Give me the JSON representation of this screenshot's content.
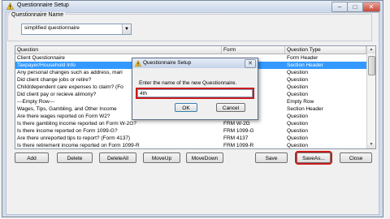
{
  "window": {
    "title": "Questionnaire Setup",
    "minimize_label": "–",
    "maximize_label": "□",
    "close_label": "✕"
  },
  "questionnaire_name": {
    "group_label": "Questionnaire Name",
    "selected_value": "simplified questionnaire",
    "arrow": "▼"
  },
  "grid": {
    "columns": [
      "Question",
      "Form",
      "Question Type"
    ],
    "rows": [
      {
        "question": "Client Questionnaire",
        "form": "",
        "type": "Form Header",
        "selected": false
      },
      {
        "question": "Taxpayer/Household Info",
        "form": "",
        "type": "Section Header",
        "selected": true
      },
      {
        "question": "Any personal changes such as address, mari",
        "form": "",
        "type": "Question",
        "selected": false
      },
      {
        "question": "Did client change jobs or retire?",
        "form": "",
        "type": "Question",
        "selected": false
      },
      {
        "question": "Child/dependent care expenses to claim? (Fo",
        "form": "",
        "type": "Question",
        "selected": false
      },
      {
        "question": "Did client pay or recieve alimony?",
        "form": "",
        "type": "Question",
        "selected": false
      },
      {
        "question": "---Empty Row---",
        "form": "",
        "type": "Empty Row",
        "selected": false
      },
      {
        "question": "Wages, Tips, Gambling, and Other Income",
        "form": "",
        "type": "Section Header",
        "selected": false
      },
      {
        "question": "Are there wages reported on Form W2?",
        "form": "FRM W-2",
        "type": "Question",
        "selected": false
      },
      {
        "question": "Is there gambling income reported on Form W-2G?",
        "form": "FRM W-2G",
        "type": "Question",
        "selected": false
      },
      {
        "question": "Is there income reported on Form 1099-G?",
        "form": "FRM 1099-G",
        "type": "Question",
        "selected": false
      },
      {
        "question": "Are there unreported tips to report?  (Form 4137)",
        "form": "FRM 4137",
        "type": "Question",
        "selected": false
      },
      {
        "question": "Is there retirement income reported on Form 1099-R",
        "form": "FRM 1099-R",
        "type": "Question",
        "selected": false
      }
    ]
  },
  "buttons": {
    "add": "Add",
    "delete": "Delete",
    "delete_all": "DeleteAll",
    "move_up": "MoveUp",
    "move_down": "MoveDown",
    "save": "Save",
    "save_as": "SaveAs...",
    "close": "Close"
  },
  "dialog": {
    "title": "Questionnaire Setup",
    "close_label": "✕",
    "prompt": "Enter the name of the new Questionnaire.",
    "input_value": "4th",
    "ok": "OK",
    "cancel": "Cancel"
  },
  "colors": {
    "selection": "#3399ff",
    "highlight_box": "#cc1a1a"
  }
}
